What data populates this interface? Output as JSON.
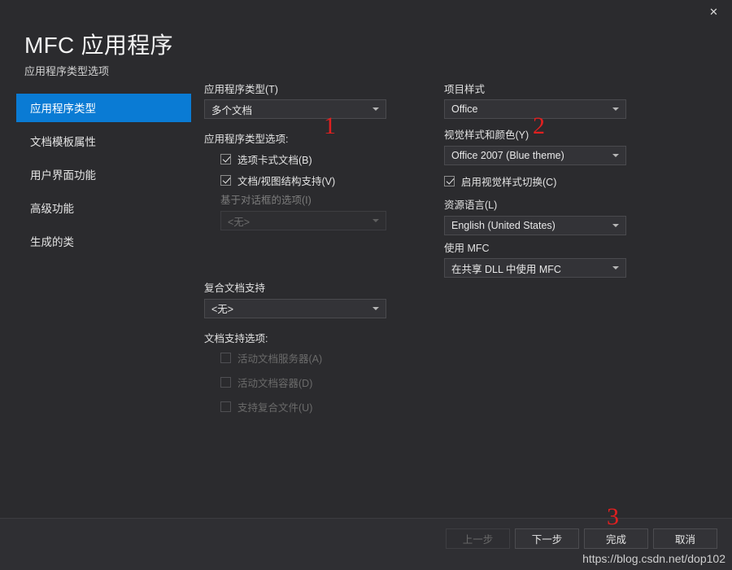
{
  "window": {
    "close_label": "✕",
    "title": "MFC 应用程序",
    "subtitle": "应用程序类型选项"
  },
  "theme": {
    "accent": "#0a7bd4",
    "background": "#2b2b2e",
    "footer_background": "#2f2f33",
    "annotation_color": "#e02020",
    "text": "#e4e4e4",
    "disabled_text": "#6b6b6b"
  },
  "sidebar": {
    "items": [
      {
        "label": "应用程序类型",
        "selected": true
      },
      {
        "label": "文档模板属性",
        "selected": false
      },
      {
        "label": "用户界面功能",
        "selected": false
      },
      {
        "label": "高级功能",
        "selected": false
      },
      {
        "label": "生成的类",
        "selected": false
      }
    ]
  },
  "left_column": {
    "app_type_label": "应用程序类型(T)",
    "app_type_value": "多个文档",
    "app_type_options_label": "应用程序类型选项:",
    "checkbox_tabbed_documents": {
      "label": "选项卡式文档(B)",
      "checked": true,
      "disabled": false
    },
    "checkbox_doc_view": {
      "label": "文档/视图结构支持(V)",
      "checked": true,
      "disabled": false
    },
    "dialog_based_options_label": "基于对话框的选项(I)",
    "dialog_based_options_value": "<无>",
    "compound_doc_label": "复合文档支持",
    "compound_doc_value": "<无>",
    "doc_support_options_label": "文档支持选项:",
    "checkbox_active_doc_server": {
      "label": "活动文档服务器(A)",
      "checked": false,
      "disabled": true
    },
    "checkbox_active_doc_container": {
      "label": "活动文档容器(D)",
      "checked": false,
      "disabled": true
    },
    "checkbox_compound_files": {
      "label": "支持复合文件(U)",
      "checked": false,
      "disabled": true
    }
  },
  "right_column": {
    "project_style_label": "项目样式",
    "project_style_value": "Office",
    "visual_style_label": "视觉样式和颜色(Y)",
    "visual_style_value": "Office 2007 (Blue theme)",
    "checkbox_enable_visual_switch": {
      "label": "启用视觉样式切换(C)",
      "checked": true,
      "disabled": false
    },
    "resource_language_label": "资源语言(L)",
    "resource_language_value": "English (United States)",
    "use_mfc_label": "使用 MFC",
    "use_mfc_value": "在共享 DLL 中使用 MFC"
  },
  "annotations": [
    {
      "id": 1,
      "text": "1"
    },
    {
      "id": 2,
      "text": "2"
    },
    {
      "id": 3,
      "text": "3"
    }
  ],
  "footer": {
    "back_label": "上一步",
    "next_label": "下一步",
    "finish_label": "完成",
    "cancel_label": "取消"
  },
  "watermark": "https://blog.csdn.net/dop102"
}
